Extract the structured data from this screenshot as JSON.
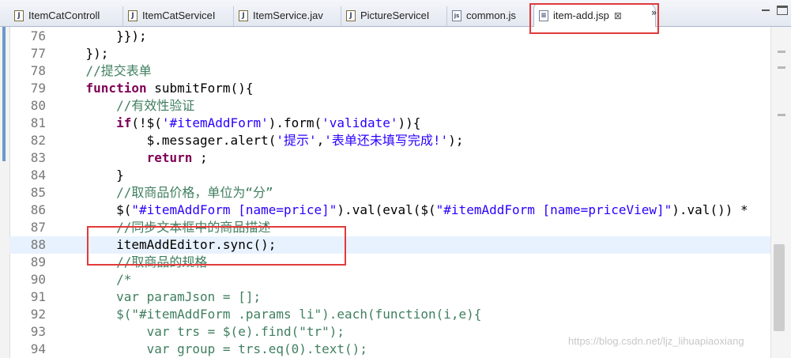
{
  "tabs": [
    {
      "label": "ItemCatControll",
      "icon": "java-file-icon",
      "glyph": "J"
    },
    {
      "label": "ItemCatServiceI",
      "icon": "java-file-icon",
      "glyph": "J"
    },
    {
      "label": "ItemService.jav",
      "icon": "java-file-icon",
      "glyph": "J"
    },
    {
      "label": "PictureServiceI",
      "icon": "java-file-icon",
      "glyph": "J"
    },
    {
      "label": "common.js",
      "icon": "js-file-icon",
      "glyph": "js"
    },
    {
      "label": "item-add.jsp",
      "icon": "jsp-file-icon",
      "glyph": "≡",
      "active": true,
      "close": "⊠"
    }
  ],
  "tab_overflow": "»",
  "editor": {
    "current_line": 88,
    "lines": [
      {
        "n": "76",
        "segs": [
          {
            "t": "        }});",
            "c": ""
          }
        ]
      },
      {
        "n": "77",
        "segs": [
          {
            "t": "    });",
            "c": ""
          }
        ]
      },
      {
        "n": "78",
        "segs": [
          {
            "t": "    ",
            "c": ""
          },
          {
            "t": "//提交表单",
            "c": "cmt"
          }
        ]
      },
      {
        "n": "79",
        "segs": [
          {
            "t": "    ",
            "c": ""
          },
          {
            "t": "function",
            "c": "kw"
          },
          {
            "t": " submitForm(){",
            "c": ""
          }
        ]
      },
      {
        "n": "80",
        "segs": [
          {
            "t": "        ",
            "c": ""
          },
          {
            "t": "//有效性验证",
            "c": "cmt"
          }
        ]
      },
      {
        "n": "81",
        "segs": [
          {
            "t": "        ",
            "c": ""
          },
          {
            "t": "if",
            "c": "kw"
          },
          {
            "t": "(!$(",
            "c": ""
          },
          {
            "t": "'#itemAddForm'",
            "c": "str"
          },
          {
            "t": ").form(",
            "c": ""
          },
          {
            "t": "'validate'",
            "c": "str"
          },
          {
            "t": ")){",
            "c": ""
          }
        ]
      },
      {
        "n": "82",
        "segs": [
          {
            "t": "            $.messager.alert(",
            "c": ""
          },
          {
            "t": "'提示'",
            "c": "str"
          },
          {
            "t": ",",
            "c": ""
          },
          {
            "t": "'表单还未填写完成!'",
            "c": "str"
          },
          {
            "t": ");",
            "c": ""
          }
        ]
      },
      {
        "n": "83",
        "segs": [
          {
            "t": "            ",
            "c": ""
          },
          {
            "t": "return",
            "c": "kw"
          },
          {
            "t": " ;",
            "c": ""
          }
        ]
      },
      {
        "n": "84",
        "segs": [
          {
            "t": "        }",
            "c": ""
          }
        ]
      },
      {
        "n": "85",
        "segs": [
          {
            "t": "        ",
            "c": ""
          },
          {
            "t": "//取商品价格，单位为“分”",
            "c": "cmt"
          }
        ]
      },
      {
        "n": "86",
        "segs": [
          {
            "t": "        $(",
            "c": ""
          },
          {
            "t": "\"#itemAddForm [name=price]\"",
            "c": "str"
          },
          {
            "t": ").val(eval($(",
            "c": ""
          },
          {
            "t": "\"#itemAddForm [name=priceView]\"",
            "c": "str"
          },
          {
            "t": ").val()) *",
            "c": ""
          }
        ]
      },
      {
        "n": "87",
        "segs": [
          {
            "t": "        ",
            "c": ""
          },
          {
            "t": "//同步文本框中的商品描述",
            "c": "cmt"
          }
        ]
      },
      {
        "n": "88",
        "segs": [
          {
            "t": "        itemAddEditor.sync();",
            "c": ""
          }
        ]
      },
      {
        "n": "89",
        "segs": [
          {
            "t": "        ",
            "c": ""
          },
          {
            "t": "//取商品的规格",
            "c": "cmt"
          }
        ]
      },
      {
        "n": "90",
        "segs": [
          {
            "t": "        ",
            "c": ""
          },
          {
            "t": "/*",
            "c": "cmt"
          }
        ]
      },
      {
        "n": "91",
        "segs": [
          {
            "t": "        ",
            "c": ""
          },
          {
            "t": "var paramJson = [];",
            "c": "cmt"
          }
        ]
      },
      {
        "n": "92",
        "segs": [
          {
            "t": "        ",
            "c": ""
          },
          {
            "t": "$(\"#itemAddForm .params li\").each(function(i,e){",
            "c": "cmt"
          }
        ]
      },
      {
        "n": "93",
        "segs": [
          {
            "t": "            ",
            "c": ""
          },
          {
            "t": "var trs = $(e).find(\"tr\");",
            "c": "cmt"
          }
        ]
      },
      {
        "n": "94",
        "segs": [
          {
            "t": "            ",
            "c": ""
          },
          {
            "t": "var group = trs.eq(0).text();",
            "c": "cmt"
          }
        ]
      }
    ]
  },
  "watermark": "https://blog.csdn.net/ljz_lihuapiaoxiang",
  "colors": {
    "keyword": "#7f0055",
    "string": "#2a00ff",
    "comment": "#3f7f5f",
    "line_number": "#787878",
    "current_line_bg": "#e8f2fe",
    "annotation": "#e23a3a"
  }
}
